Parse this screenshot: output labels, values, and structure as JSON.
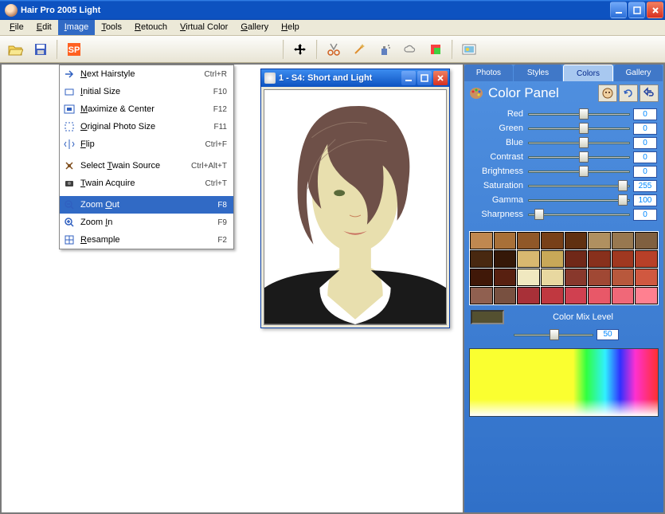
{
  "window": {
    "title": "Hair Pro 2005  Light"
  },
  "menu": {
    "items": [
      "File",
      "Edit",
      "Image",
      "Tools",
      "Retouch",
      "Virtual Color",
      "Gallery",
      "Help"
    ],
    "open_index": 2
  },
  "image_menu": [
    {
      "icon": "next",
      "label": "Next Hairstyle",
      "underline": 0,
      "shortcut": "Ctrl+R"
    },
    {
      "icon": "initial",
      "label": "Initial Size",
      "underline": 0,
      "shortcut": "F10"
    },
    {
      "icon": "maxcenter",
      "label": "Maximize & Center",
      "underline": 0,
      "shortcut": "F12"
    },
    {
      "icon": "origsize",
      "label": "Original Photo Size",
      "underline": 0,
      "shortcut": "F11"
    },
    {
      "icon": "flip",
      "label": "Flip",
      "underline": 0,
      "shortcut": "Ctrl+F"
    },
    {
      "sep": true
    },
    {
      "icon": "twainsrc",
      "label": "Select Twain Source",
      "underline": 7,
      "shortcut": "Ctrl+Alt+T"
    },
    {
      "icon": "twainacq",
      "label": "Twain Acquire",
      "underline": 0,
      "shortcut": "Ctrl+T"
    },
    {
      "sep": true
    },
    {
      "icon": "zoomout",
      "label": "Zoom Out",
      "underline": 5,
      "shortcut": "F8",
      "highlight": true
    },
    {
      "icon": "zoomin",
      "label": "Zoom In",
      "underline": 5,
      "shortcut": "F9"
    },
    {
      "icon": "resample",
      "label": "Resample",
      "underline": 0,
      "shortcut": "F2"
    }
  ],
  "child_window": {
    "title": "1 - S4: Short and Light"
  },
  "side_tabs": [
    "Photos",
    "Styles",
    "Colors",
    "Gallery"
  ],
  "side_tab_active": 2,
  "panel": {
    "title": "Color Panel"
  },
  "sliders": [
    {
      "label": "Red",
      "value": 0,
      "pos": 50
    },
    {
      "label": "Green",
      "value": 0,
      "pos": 50
    },
    {
      "label": "Blue",
      "value": 0,
      "pos": 50
    },
    {
      "label": "Contrast",
      "value": 0,
      "pos": 50
    },
    {
      "label": "Brightness",
      "value": 0,
      "pos": 50
    },
    {
      "label": "Saturation",
      "value": 255,
      "pos": 100
    },
    {
      "label": "Gamma",
      "value": 100,
      "pos": 100
    },
    {
      "label": "Sharpness",
      "value": 0,
      "pos": 6
    }
  ],
  "mix": {
    "label": "Color Mix Level",
    "value": 50,
    "swatch": "#545030"
  },
  "swatches": [
    "#c08850",
    "#a87038",
    "#905828",
    "#784018",
    "#603010",
    "#b09060",
    "#987850",
    "#806040",
    "#482810",
    "#351808",
    "#d8b870",
    "#c8a858",
    "#702818",
    "#88301c",
    "#a03820",
    "#b84028",
    "#401808",
    "#582010",
    "#f0e8c0",
    "#e8d8a0",
    "#88382c",
    "#a04834",
    "#b8583c",
    "#d05840",
    "#906050",
    "#785040",
    "#a83038",
    "#c03840",
    "#d04050",
    "#e85868",
    "#f06878",
    "#ff8090"
  ]
}
